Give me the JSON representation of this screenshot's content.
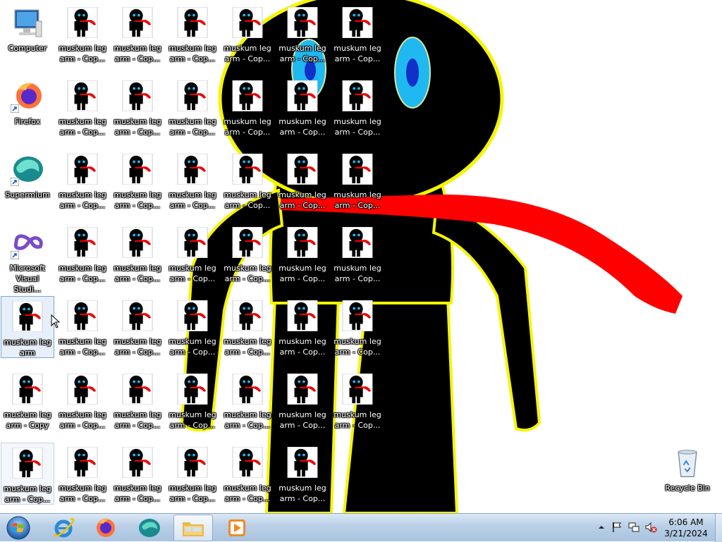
{
  "desktop": {
    "icons": [
      {
        "name": "computer-icon",
        "label": "Computer",
        "kind": "computer"
      },
      {
        "name": "firefox-icon",
        "label": "Firefox",
        "kind": "firefox",
        "shortcut": true
      },
      {
        "name": "supermium-icon",
        "label": "Supermium",
        "kind": "supermium",
        "shortcut": true
      },
      {
        "name": "visual-studio-icon",
        "label": "Microsoft Visual Studi...",
        "kind": "vs",
        "shortcut": true
      },
      {
        "name": "muskum-leg-arm-icon",
        "label": "muskum leg arm",
        "kind": "thumb",
        "state": "selected"
      },
      {
        "name": "muskum-leg-arm-copy-icon",
        "label": "muskum leg arm - Copy",
        "kind": "thumb"
      },
      {
        "name": "muskum-leg-arm-copy-icon",
        "label": "muskum leg arm - Cop...",
        "kind": "thumb",
        "state": "hover"
      }
    ],
    "copy_label": "muskum leg arm - Cop...",
    "recycle_bin_label": "Recycle Bin"
  },
  "taskbar": {
    "start": "start-orb",
    "pinned": [
      "internet-explorer",
      "firefox",
      "supermium",
      "file-explorer",
      "media-player"
    ],
    "active": "file-explorer",
    "clock_time": "6:06 AM",
    "clock_date": "3/21/2024",
    "tray": [
      "show-hidden-icons",
      "action-center-flag",
      "network",
      "volume-muted"
    ]
  },
  "colors": {
    "figure_body": "#000000",
    "figure_outline": "#f5f500",
    "scarf": "#ff0000",
    "eye_outer": "#1fb8f0",
    "eye_pupil": "#1030c8",
    "taskbar": "#b9cfe6"
  }
}
